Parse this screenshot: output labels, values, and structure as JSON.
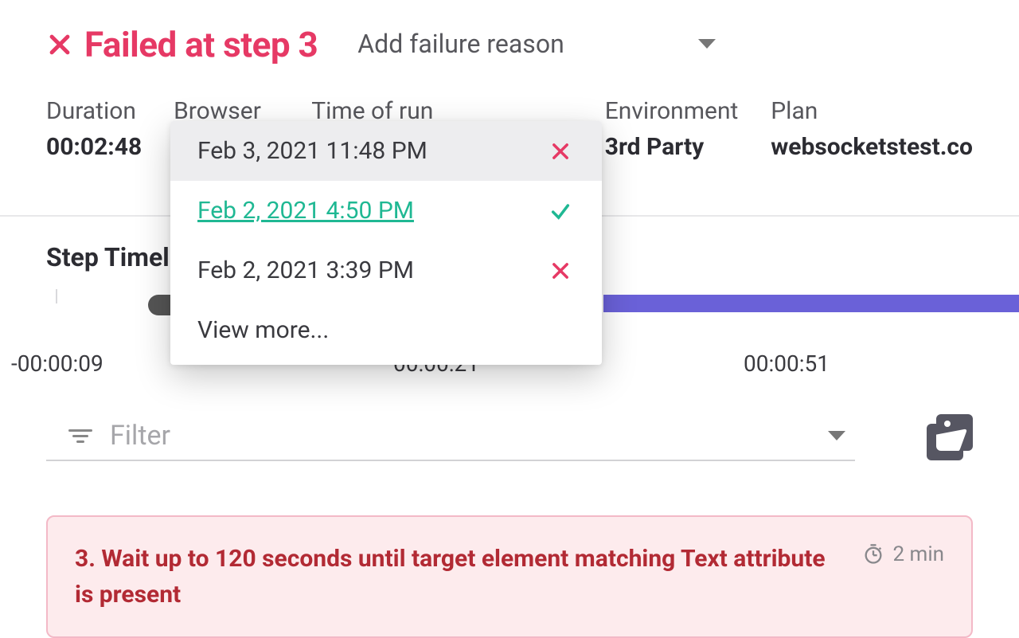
{
  "header": {
    "title": "Failed at step 3",
    "failure_reason_placeholder": "Add failure reason"
  },
  "meta": {
    "duration_label": "Duration",
    "duration_value": "00:02:48",
    "browser_label": "Browser",
    "time_of_run_label": "Time of run",
    "environment_label": "Environment",
    "environment_value": "3rd Party",
    "plan_label": "Plan",
    "plan_value": "websocketstest.co"
  },
  "runs_dropdown": {
    "items": [
      {
        "label": "Feb 3, 2021 11:48 PM",
        "status": "fail",
        "highlighted": true
      },
      {
        "label": "Feb 2, 2021 4:50 PM",
        "status": "pass",
        "highlighted": false
      },
      {
        "label": "Feb 2, 2021 3:39 PM",
        "status": "fail",
        "highlighted": false
      }
    ],
    "view_more": "View more..."
  },
  "timeline": {
    "section_title": "Step Timel",
    "labels": {
      "left": "-00:00:09",
      "mid": "00:00:21",
      "right": "00:00:51"
    }
  },
  "filter": {
    "placeholder": "Filter"
  },
  "step_card": {
    "text": "3. Wait up to 120 seconds until target element matching Text attribute is present",
    "duration": "2 min"
  }
}
